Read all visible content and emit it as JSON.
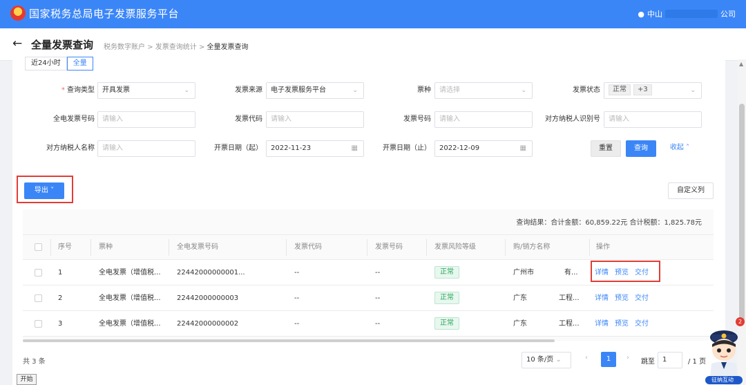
{
  "topbar": {
    "title": "国家税务总局电子发票服务平台",
    "user_prefix": "中山",
    "user_suffix": "公司"
  },
  "header": {
    "title": "全量发票查询",
    "breadcrumb": [
      "税务数字账户",
      "发票查询统计",
      "全量发票查询"
    ],
    "breadcrumb_sep": ">"
  },
  "tabs": [
    "近24小时",
    "全量"
  ],
  "form": {
    "query_type": {
      "label": "查询类型",
      "value": "开具发票"
    },
    "source": {
      "label": "发票来源",
      "value": "电子发票服务平台"
    },
    "kind": {
      "label": "票种",
      "placeholder": "请选择"
    },
    "status": {
      "label": "发票状态",
      "tag1": "正常",
      "tag2": "+3"
    },
    "full_no": {
      "label": "全电发票号码",
      "placeholder": "请输入"
    },
    "code": {
      "label": "发票代码",
      "placeholder": "请输入"
    },
    "number": {
      "label": "发票号码",
      "placeholder": "请输入"
    },
    "tax_id": {
      "label": "对方纳税人识别号",
      "placeholder": "请输入"
    },
    "party_name": {
      "label": "对方纳税人名称",
      "placeholder": "请输入"
    },
    "date_start": {
      "label": "开票日期（起）",
      "value": "2022-11-23"
    },
    "date_end": {
      "label": "开票日期（止）",
      "value": "2022-12-09"
    },
    "reset": "重置",
    "search": "查询",
    "collapse": "收起"
  },
  "toolbar": {
    "export": "导出",
    "custom_columns": "自定义列"
  },
  "summary": "查询结果：合计金额：60,859.22元   合计税额：1,825.78元",
  "table": {
    "headers": [
      "序号",
      "票种",
      "全电发票号码",
      "发票代码",
      "发票号码",
      "发票风险等级",
      "购/销方名称",
      "操作"
    ],
    "rows": [
      {
        "idx": "1",
        "kind": "全电发票（增值税...",
        "no": "22442000000001...",
        "code": "--",
        "number": "--",
        "risk": "正常",
        "name_a": "广州市",
        "name_b": "有..."
      },
      {
        "idx": "2",
        "kind": "全电发票（增值税...",
        "no": "22442000000003",
        "code": "--",
        "number": "--",
        "risk": "正常",
        "name_a": "广东",
        "name_b": "工程..."
      },
      {
        "idx": "3",
        "kind": "全电发票（增值税...",
        "no": "22442000000002",
        "code": "--",
        "number": "--",
        "risk": "正常",
        "name_a": "广东",
        "name_b": "工程..."
      }
    ],
    "ops": [
      "详情",
      "预览",
      "交付"
    ]
  },
  "pagination": {
    "total": "共 3 条",
    "page_size": "10 条/页",
    "current": "1",
    "jump_label": "跳至",
    "jump_value": "1",
    "pages": "/ 1 页"
  },
  "taskbar": {
    "start": "开始"
  },
  "assistant": {
    "badge": "2",
    "label": "征纳互动"
  },
  "colors": {
    "primary": "#3b86f7",
    "highlight": "#e23c33",
    "success": "#2ba65a"
  }
}
